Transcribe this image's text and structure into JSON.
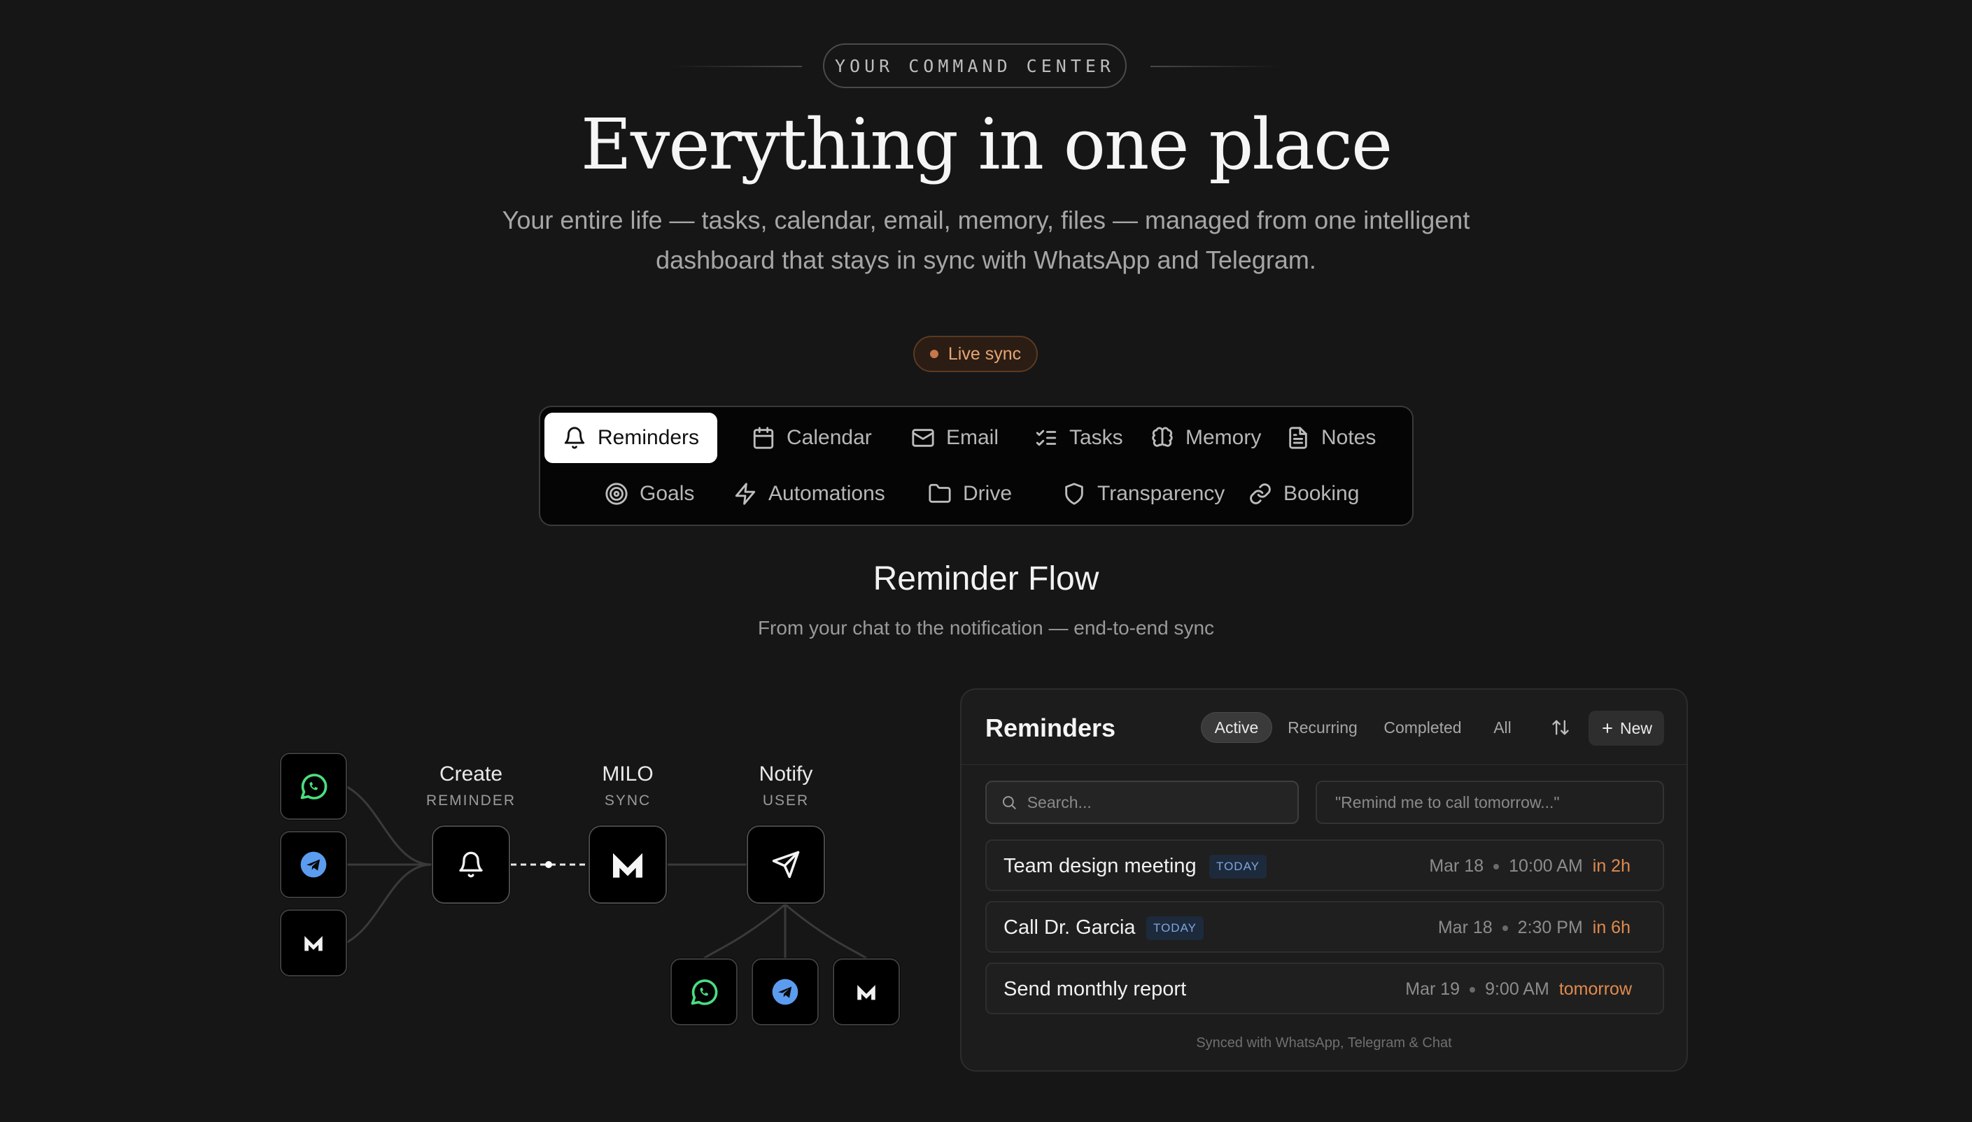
{
  "header": {
    "eyebrow": "YOUR COMMAND CENTER",
    "title": "Everything in one place",
    "subtitle_line1": "Your entire life — tasks, calendar, email, memory, files — managed from one intelligent",
    "subtitle_line2": "dashboard that stays in sync with WhatsApp and Telegram.",
    "live_badge": "Live sync"
  },
  "tabs": [
    {
      "label": "Reminders",
      "icon": "bell-icon",
      "active": true
    },
    {
      "label": "Calendar",
      "icon": "calendar-icon"
    },
    {
      "label": "Email",
      "icon": "mail-icon"
    },
    {
      "label": "Tasks",
      "icon": "list-checks-icon"
    },
    {
      "label": "Memory",
      "icon": "brain-icon"
    },
    {
      "label": "Notes",
      "icon": "file-text-icon"
    },
    {
      "label": "Goals",
      "icon": "target-icon"
    },
    {
      "label": "Automations",
      "icon": "zap-icon"
    },
    {
      "label": "Drive",
      "icon": "folder-icon"
    },
    {
      "label": "Transparency",
      "icon": "shield-icon"
    },
    {
      "label": "Booking",
      "icon": "link-icon"
    }
  ],
  "section": {
    "title": "Reminder Flow",
    "subtitle": "From your chat to the notification — end-to-end sync"
  },
  "flow": {
    "create_label": "Create",
    "create_sub": "REMINDER",
    "sync_label": "MILO",
    "sync_sub": "SYNC",
    "notify_label": "Notify",
    "notify_sub": "USER",
    "colors": {
      "whatsapp": "#4ade80",
      "telegram": "#5b9cf0"
    }
  },
  "reminders": {
    "title": "Reminders",
    "filters": [
      "Active",
      "Recurring",
      "Completed",
      "All"
    ],
    "active_filter": "Active",
    "new_label": "New",
    "search_placeholder": "Search...",
    "quick_add_placeholder": "\"Remind me to call tomorrow...\"",
    "items": [
      {
        "title": "Team design meeting",
        "badge": "TODAY",
        "date": "Mar 18",
        "time": "10:00 AM",
        "relative": "in 2h"
      },
      {
        "title": "Call Dr. Garcia",
        "badge": "TODAY",
        "date": "Mar 18",
        "time": "2:30 PM",
        "relative": "in 6h"
      },
      {
        "title": "Send monthly report",
        "badge": "",
        "date": "Mar 19",
        "time": "9:00 AM",
        "relative": "tomorrow"
      }
    ],
    "footer": "Synced with WhatsApp, Telegram & Chat",
    "accent": "#e08a4e"
  }
}
